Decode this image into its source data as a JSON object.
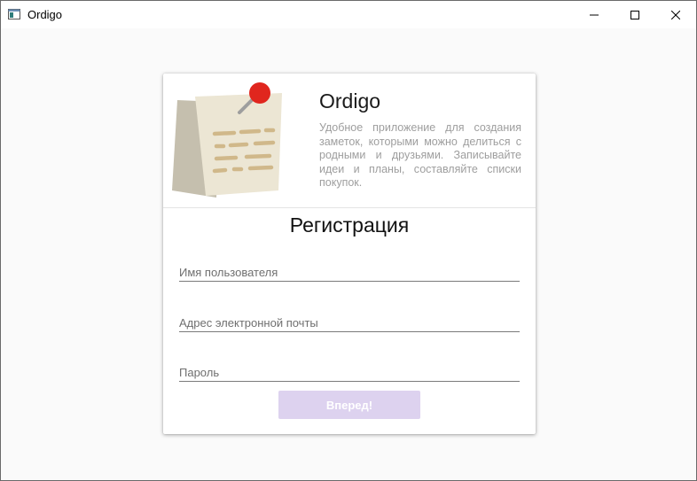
{
  "window": {
    "title": "Ordigo",
    "icon": "app-window-icon",
    "controls": [
      "minimize-icon",
      "maximize-icon",
      "close-icon"
    ]
  },
  "hero": {
    "app_name": "Ordigo",
    "description": "Удобное приложение для создания заметок, которыми можно делиться с родными и друзьями. Записывайте идеи и планы, составляйте списки покупок.",
    "image": "pinned-note-icon"
  },
  "form": {
    "title": "Регистрация",
    "username": {
      "placeholder": "Имя пользователя",
      "value": ""
    },
    "email": {
      "placeholder": "Адрес электронной почты",
      "value": ""
    },
    "password": {
      "placeholder": "Пароль",
      "value": ""
    },
    "submit_label": "Вперед!",
    "submit_enabled": false
  },
  "colors": {
    "background": "#fafafa",
    "card": "#ffffff",
    "button_disabled": "#ddd2ef",
    "pin": "#e0261e",
    "note_paper": "#ece6d4",
    "note_lines": "#d0b88a"
  }
}
